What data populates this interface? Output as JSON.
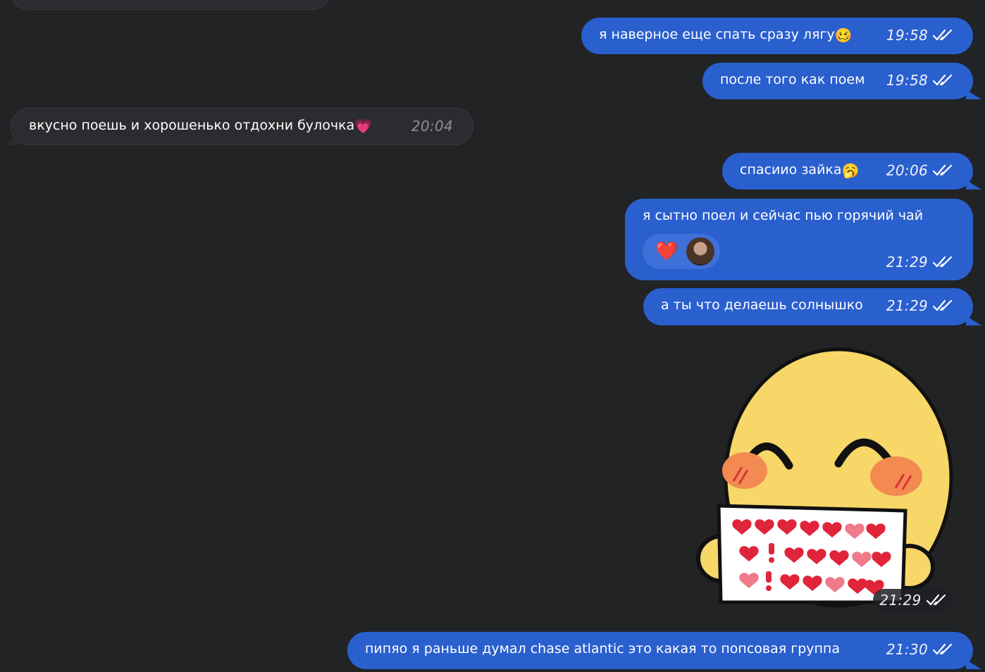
{
  "messages": [
    {
      "text": "я наверное еще спать сразу лягу",
      "emoji": "🥴",
      "time": "19:58",
      "direction": "out"
    },
    {
      "text": "после того как поем",
      "time": "19:58",
      "direction": "out"
    },
    {
      "text": "вкусно поешь и хорошенько отдохни булочка",
      "emoji": "💗",
      "time": "20:04",
      "direction": "in"
    },
    {
      "text": "спасиио зайка",
      "emoji": "🥱",
      "time": "20:06",
      "direction": "out"
    },
    {
      "text": "я сытно поел и сейчас пью горячий чай",
      "time": "21:29",
      "direction": "out",
      "reaction": "❤️"
    },
    {
      "text": "а ты что делаешь солнышко",
      "time": "21:29",
      "direction": "out"
    },
    {
      "type": "sticker",
      "time": "21:29",
      "direction": "out"
    },
    {
      "text": "пипяо я раньше думал chase atlantic это какая то попсовая группа",
      "time": "21:30",
      "direction": "out"
    }
  ],
  "colors": {
    "background": "#212325",
    "outgoing_bubble": "#2a5fce",
    "incoming_bubble": "#2a2c2f",
    "sticker_face": "#f7d767",
    "sticker_cheek": "#f38a52",
    "heart": "#e0243a"
  },
  "icons": {
    "read_receipt": "double-check-icon",
    "sticker": "smiling-face-holding-hearts-sign"
  }
}
